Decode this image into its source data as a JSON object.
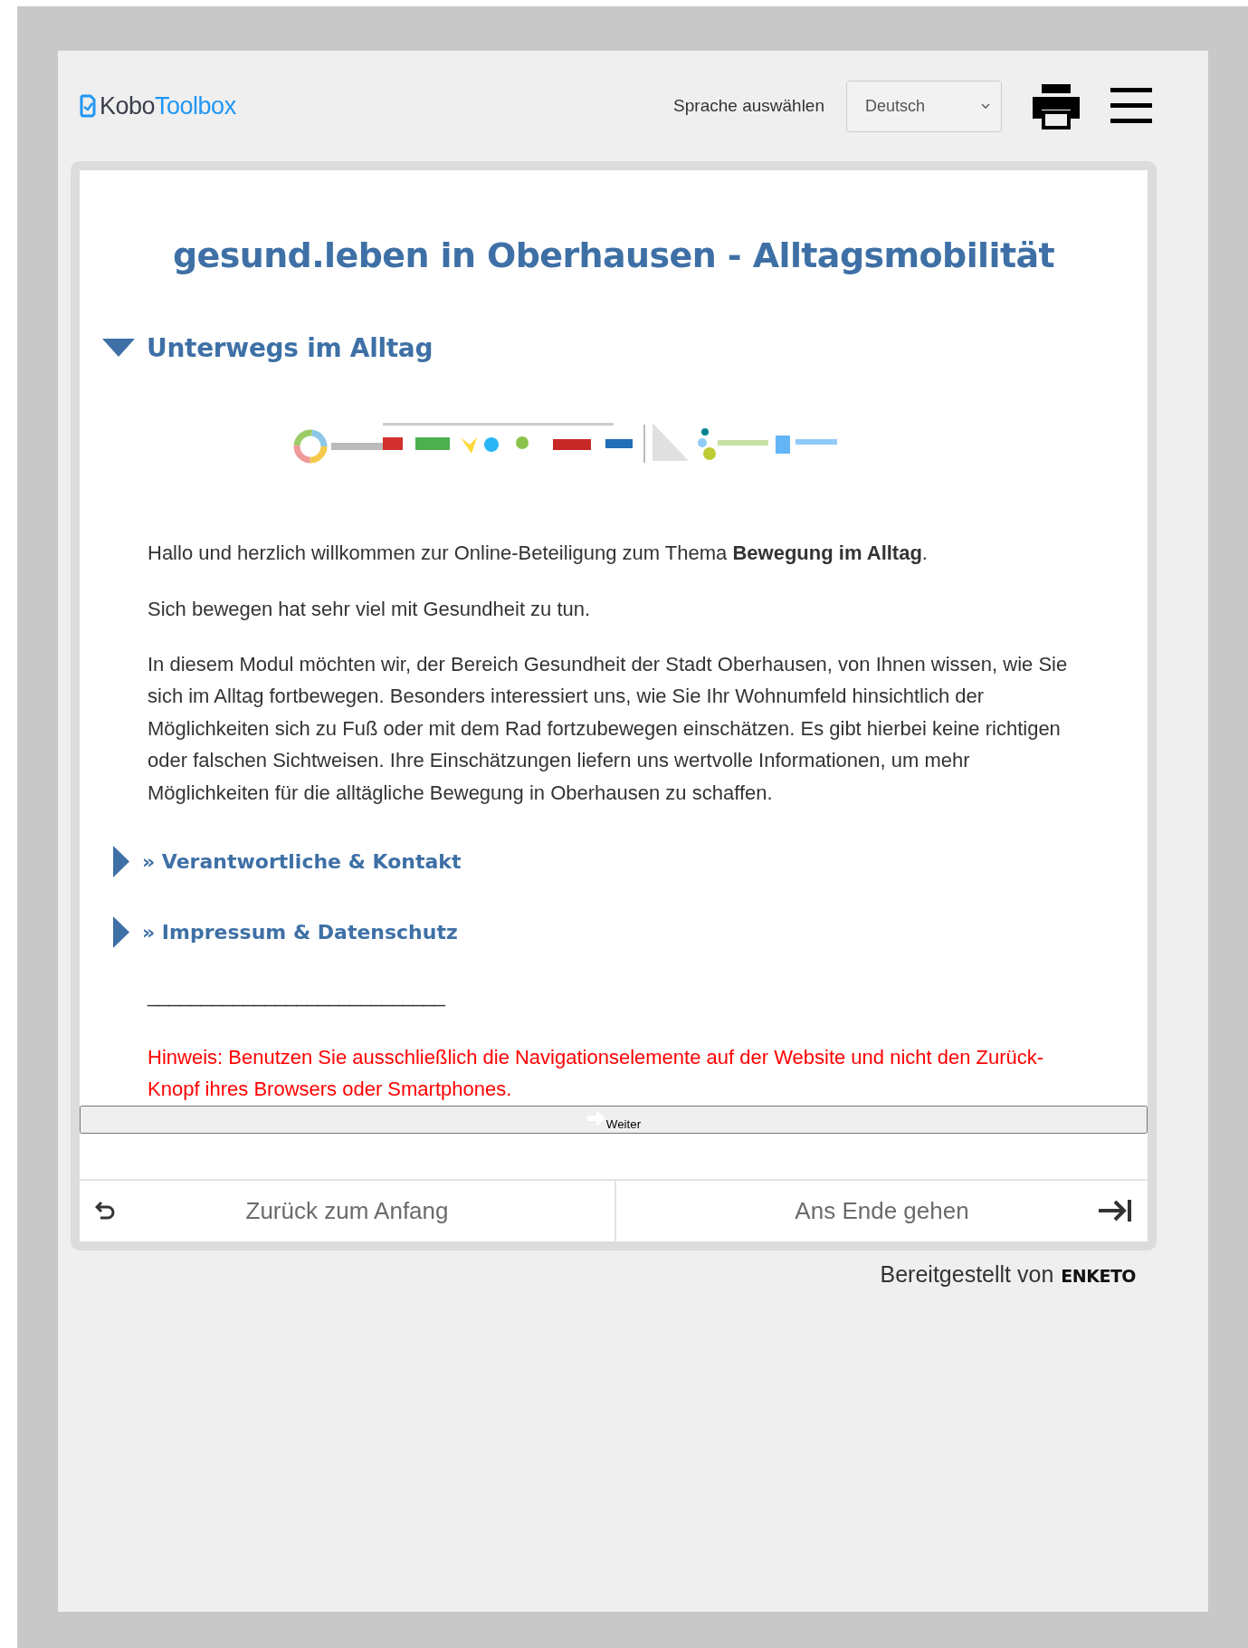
{
  "header": {
    "logo": {
      "part_1": "Kobo",
      "part_2": "Toolbox"
    },
    "language_label": "Sprache auswählen",
    "language_select": {
      "value": "Deutsch"
    }
  },
  "form": {
    "title": "gesund.leben in Oberhausen - Alltagsmobilität",
    "group": {
      "heading": "Unterwegs im Alltag",
      "expanded": true,
      "paragraphs": [
        "Hallo und herzlich willkommen zur Online-Beteiligung zum Thema **Bewegung im Alltag**.",
        "Sich bewegen hat sehr viel mit Gesundheit zu tun.",
        "In diesem Modul möchten wir, der Bereich Gesundheit der Stadt Oberhausen, von Ihnen wissen, wie Sie sich im Alltag fortbewegen. Besonders interessiert uns, wie Sie Ihr Wohnumfeld hinsichtlich der Möglichkeiten sich zu Fuß oder mit dem Rad fortzubewegen einschätzen. Es gibt hierbei keine richtigen oder falschen Sichtweisen. Ihre Einschätzungen liefern uns wertvolle Informationen, um mehr Möglichkeiten für die alltägliche Bewegung in Oberhausen zu schaffen."
      ],
      "sections": [
        {
          "label": "» Verantwortliche & Kontakt",
          "expanded": false
        },
        {
          "label": "» Impressum & Datenschutz",
          "expanded": false
        }
      ],
      "separator": "____________________________",
      "notice": "Hinweis: Benutzen Sie ausschließlich die Navigationselemente auf der Website und nicht den Zurück-Knopf ihres Browsers oder Smartphones."
    },
    "next_button": "Weiter",
    "nav": {
      "back": "Zurück zum Anfang",
      "end": "Ans Ende gehen"
    }
  },
  "footer": {
    "text": "Bereitgestellt von",
    "brand": "ENKETO"
  }
}
